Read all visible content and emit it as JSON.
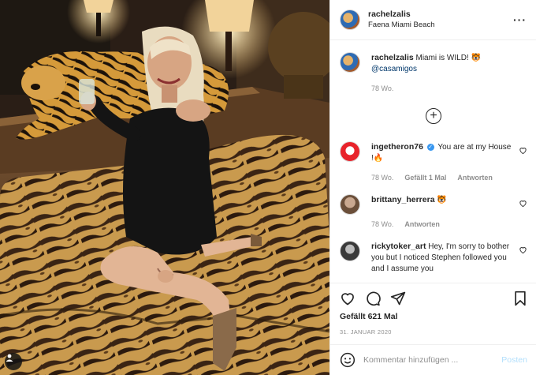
{
  "post": {
    "author": "rachelzalis",
    "location": "Faena Miami Beach",
    "caption": {
      "username": "rachelzalis",
      "text": "Miami is WILD! 🐯",
      "mention": "@casamigos",
      "time": "78 Wo."
    },
    "comments": [
      {
        "username": "ingetheron76",
        "verified": true,
        "text": "You are at my House !🔥",
        "time": "78 Wo.",
        "likes": "Gefällt 1 Mal",
        "reply": "Antworten",
        "avatar_color": "#e8232b"
      },
      {
        "username": "brittany_herrera",
        "text": "🐯",
        "time": "78 Wo.",
        "reply": "Antworten",
        "avatar_color": "#b89a82"
      },
      {
        "username": "rickytoker_art",
        "text": "Hey, I'm sorry to bother you but I noticed Stephen followed you and I assume you",
        "avatar_color": "#7a7a7a"
      }
    ],
    "likes_count": "Gefällt 621 Mal",
    "date": "31. JANUAR 2020",
    "composer": {
      "placeholder": "Kommentar hinzufügen ...",
      "post_label": "Posten"
    }
  },
  "icons": {
    "header_more": "more-horizontal-icon",
    "load_more": "plus-circle-icon",
    "like": "heart-icon",
    "comment": "comment-icon",
    "share": "paper-plane-icon",
    "save": "bookmark-icon",
    "emoji": "emoji-icon",
    "user_tag": "user-icon"
  },
  "colors": {
    "link": "#00376b",
    "verified": "#3897f0",
    "muted": "#8e8e8e",
    "post_button": "#b2dffc"
  }
}
